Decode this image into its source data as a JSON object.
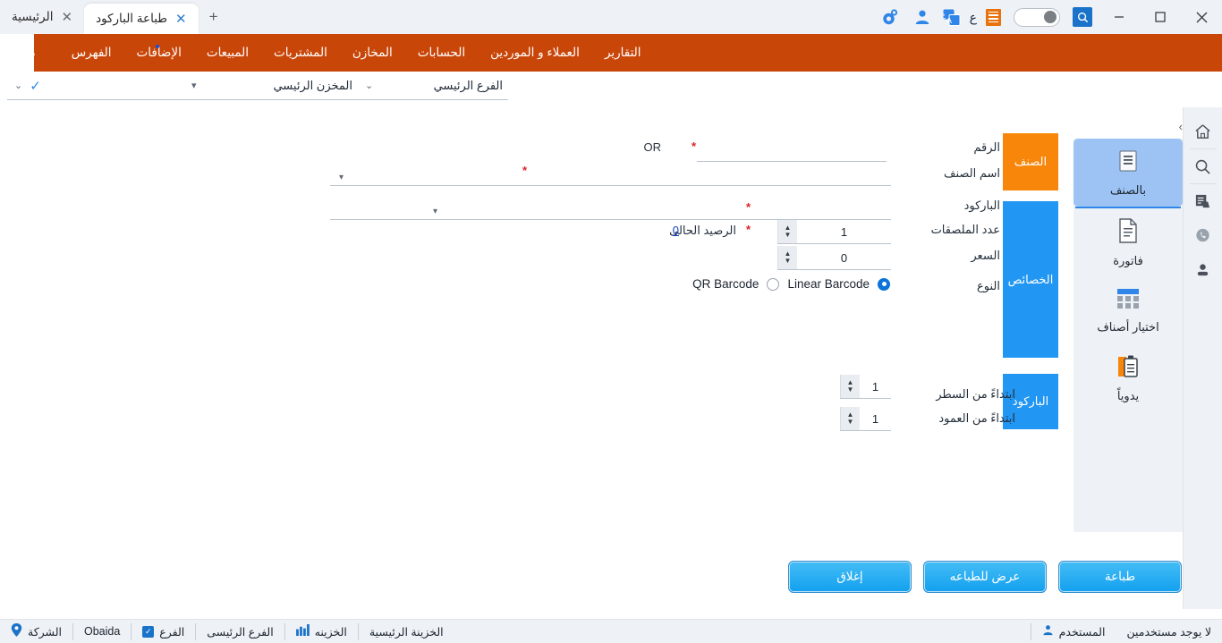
{
  "titlebar": {
    "window_controls": [
      "close",
      "maximize",
      "minimize"
    ],
    "icons": [
      "search-icon",
      "toggle-switch",
      "orange-menu-icon",
      "arabic-letter-ain",
      "translate-icon",
      "user-icon",
      "settings-gear-icon"
    ],
    "arabic_letter": "ع",
    "new_tab_label": "+",
    "tabs": [
      {
        "label": "طباعة الباركود",
        "active": true
      },
      {
        "label": "الرئيسية",
        "active": false
      }
    ]
  },
  "menubar": {
    "items": [
      {
        "label": "ملف"
      },
      {
        "label": "الفهرس"
      },
      {
        "label": "الإضافات"
      },
      {
        "label": "المبيعات"
      },
      {
        "label": "المشتريات"
      },
      {
        "label": "المخازن"
      },
      {
        "label": "الحسابات"
      },
      {
        "label": "العملاء و الموردين"
      },
      {
        "label": "التقارير"
      }
    ],
    "bg_color": "#c94609"
  },
  "selectors": [
    {
      "name": "branch",
      "value": "الفرع الرئيسي"
    },
    {
      "name": "store",
      "value": "المخزن الرئيسي"
    },
    {
      "name": "extra",
      "value": ""
    }
  ],
  "sidebar": {
    "expand_caret": "›",
    "modes": [
      {
        "label": "بالصنف",
        "icon": "list-document-icon",
        "active": true
      },
      {
        "label": "فاتورة",
        "icon": "invoice-icon",
        "active": false
      },
      {
        "label": "اختيار أصناف",
        "icon": "grid-select-icon",
        "active": false
      },
      {
        "label": "يدوياً",
        "icon": "clipboard-icon",
        "active": false
      }
    ],
    "rail_icons": [
      "home-icon",
      "search-icon",
      "report-icon",
      "phone-chat-icon",
      "user-icon"
    ]
  },
  "vtabs": [
    {
      "label": "الصنف",
      "color": "#f7860b"
    },
    {
      "label": "الخصائص",
      "color": "#2196f3"
    },
    {
      "label": "الباركود",
      "color": "#2196f3"
    }
  ],
  "form": {
    "fields": {
      "number": {
        "label": "الرقم",
        "value": "",
        "required": true
      },
      "item_name": {
        "label": "اسم الصنف",
        "value": "",
        "required": true
      },
      "barcode": {
        "label": "الباركود",
        "value": "",
        "required": true
      },
      "labels_count": {
        "label": "عدد الملصقات",
        "value": "1",
        "required": true
      },
      "price": {
        "label": "السعر",
        "value": "0"
      },
      "type": {
        "label": "النوع"
      },
      "start_row": {
        "label": "ابتداءً من السطر",
        "value": "1"
      },
      "start_column": {
        "label": "ابتداءً من العمود",
        "value": "1"
      }
    },
    "or_label": "OR",
    "required_mark": "*",
    "balance": {
      "label": "الرصيد الحالى",
      "value": "0"
    },
    "barcode_type": {
      "linear": {
        "label": "Linear Barcode",
        "selected": true
      },
      "qr": {
        "label": "QR Barcode",
        "selected": false
      }
    }
  },
  "buttons": [
    {
      "label": "طباعة",
      "name": "print"
    },
    {
      "label": "عرض للطباعه",
      "name": "print-preview"
    },
    {
      "label": "إغلاق",
      "name": "close"
    }
  ],
  "statusbar": {
    "right": [
      {
        "label": "الشركة",
        "value": "Obaida",
        "icon": "location-pin-icon"
      },
      {
        "label": "الفرع",
        "value": "الفرع الرئيسى",
        "icon": "checkbox-icon"
      },
      {
        "label": "الخزينه",
        "value": "الخزينة الرئيسية",
        "icon": "bars-icon"
      }
    ],
    "left": [
      {
        "label": "المستخدم",
        "value": "لا يوجد مستخدمين",
        "icon": "user-icon"
      }
    ]
  }
}
